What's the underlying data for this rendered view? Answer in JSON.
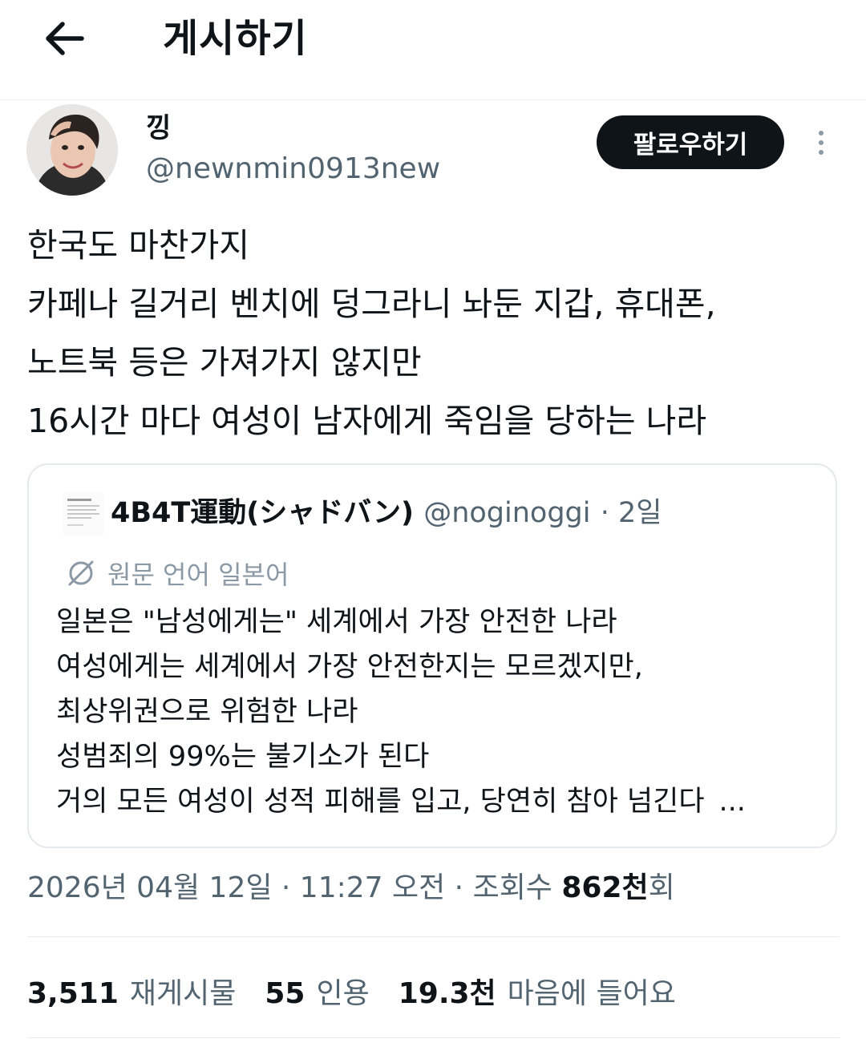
{
  "header": {
    "title": "게시하기",
    "back_icon": "arrow-left-icon"
  },
  "author": {
    "display_name": "낑",
    "handle": "@newnmin0913new",
    "follow_label": "팔로우하기",
    "more_icon": "more-vertical-icon"
  },
  "tweet": {
    "lines": [
      "한국도 마찬가지",
      "카페나 길거리 벤치에 덩그라니 놔둔 지갑, 휴대폰,",
      "노트북 등은 가져가지 않지만",
      "16시간 마다 여성이 남자에게 죽임을 당하는 나라"
    ]
  },
  "quote": {
    "author_name": "4B4T運動(シャドバン)",
    "author_handle": "@noginoggi",
    "time": "· 2일",
    "translate_label": "원문 언어 일본어",
    "lines": [
      "일본은 \"남성에게는\" 세계에서 가장 안전한 나라",
      "여성에게는 세계에서 가장 안전한지는 모르겠지만,",
      "최상위권으로 위험한 나라",
      "성범죄의 99%는 불기소가 된다",
      "거의 모든 여성이 성적 피해를 입고, 당연히 참아 넘긴다"
    ],
    "ellipsis": "..."
  },
  "meta": {
    "timestamp": "2026년 04월 12일 · 11:27 오전 · 조회수 ",
    "views_count": "862천",
    "views_suffix": "회"
  },
  "stats": {
    "reposts_count": "3,511",
    "reposts_label": "재게시물",
    "quotes_count": "55",
    "quotes_label": "인용",
    "likes_count": "19.3천",
    "likes_label": "마음에 들어요"
  },
  "colors": {
    "text_primary": "#0f1419",
    "text_secondary": "#536471",
    "border": "#e4e9ec",
    "follow_bg": "#0f1419"
  }
}
